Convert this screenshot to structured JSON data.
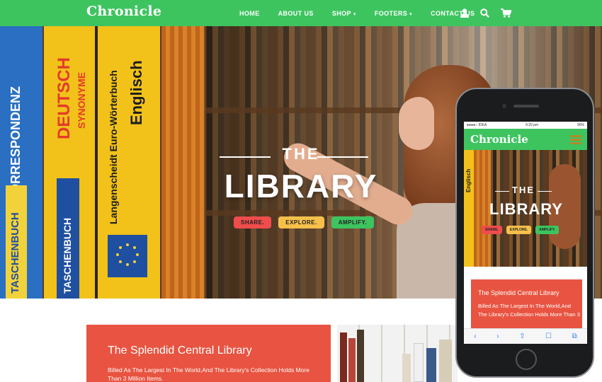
{
  "brand": {
    "logo": "Chronicle",
    "accent": "#3ec45f",
    "card_color": "#e85441"
  },
  "nav": {
    "items": [
      {
        "label": "HOME",
        "dropdown": false
      },
      {
        "label": "ABOUT US",
        "dropdown": false
      },
      {
        "label": "SHOP",
        "dropdown": true
      },
      {
        "label": "FOOTERS",
        "dropdown": true
      },
      {
        "label": "CONTACT US",
        "dropdown": false
      }
    ],
    "icons": [
      "user-icon",
      "search-icon",
      "cart-icon"
    ]
  },
  "hero": {
    "title_small": "THE",
    "title_large": "LIBRARY",
    "tags": [
      {
        "label": "SHARE.",
        "color": "#ef4c4c"
      },
      {
        "label": "EXPLORE.",
        "color": "#f7c04b"
      },
      {
        "label": "AMPLIFY.",
        "color": "#3ec45f"
      }
    ],
    "book_spines": [
      "KORRESPONDENZ",
      "TASCHENBUCH",
      "DEUTSCH",
      "SYNONYME",
      "TASCHENBUCH",
      "Langenscheidt  Euro-Wörterbuch",
      "Englisch"
    ]
  },
  "content": {
    "heading": "The Splendid Central Library",
    "body": "Billed As The Largest In The World,And The Library's Collection Holds More Than 3 Million Items."
  },
  "phone": {
    "status_left": "●●●●○ IDEA",
    "status_time": "9:20 pm",
    "status_right": "90%",
    "logo": "Chronicle",
    "title_small": "THE",
    "title_large": "LIBRARY",
    "tags": [
      {
        "label": "SHARE.",
        "color": "#ef4c4c"
      },
      {
        "label": "EXPLORE.",
        "color": "#f7c04b"
      },
      {
        "label": "AMPLIFY.",
        "color": "#3ec45f"
      }
    ],
    "spine_text": "Englisch",
    "card_heading": "The Splendid Central Library",
    "card_body": "Billed As The Largest In The World,And The Library's Collection Holds More Than 3",
    "toolbar": [
      "‹",
      "›",
      "⇧",
      "☐",
      "⧉"
    ]
  }
}
